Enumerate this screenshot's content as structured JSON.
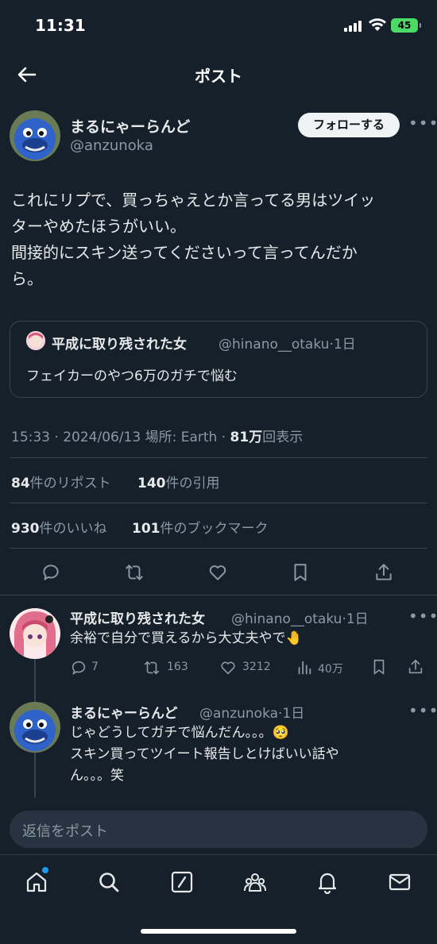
{
  "status_bar": {
    "time": "11:31",
    "battery": "45"
  },
  "header": {
    "title": "ポスト"
  },
  "post": {
    "author_name": "まるにゃーらんど",
    "author_handle": "@anzunoka",
    "follow_label": "フォローする",
    "text": "これにリプで、買っちゃえとか言ってる男はツイッ\nターやめたほうがいい。\n間接的にスキン送ってくださいって言ってんだか\nら。",
    "quote": {
      "name": "平成に取り残された女",
      "handle": "@hinano__otaku·1日",
      "text": "フェイカーのやつ6万のガチで悩む"
    },
    "meta_prefix": "15:33 · 2024/06/13 場所: Earth · ",
    "views_count": "81万",
    "views_label": "回表示",
    "reposts_count": "84",
    "reposts_label": "件のリポスト",
    "quotes_count": "140",
    "quotes_label": "件の引用",
    "likes_count": "930",
    "likes_label": "件のいいね",
    "bookmarks_count": "101",
    "bookmarks_label": "件のブックマーク"
  },
  "replies": [
    {
      "name": "平成に取り残された女",
      "handle": "@hinano__otaku·1日",
      "text": "余裕で自分で買えるから大丈夫やで🤚",
      "replies": "7",
      "reposts": "163",
      "likes": "3212",
      "views": "40万"
    },
    {
      "name": "まるにゃーらんど",
      "handle": "@anzunoka·1日",
      "text": "じゃどうしてガチで悩んだん。。。🥺\nスキン買ってツイート報告しとけばいい話や\nん。。。笑"
    }
  ],
  "reply_bar": {
    "placeholder": "返信をポスト"
  },
  "colors": {
    "background": "#15202b",
    "text": "#e7e9ea",
    "muted": "#8b98a5",
    "divider": "#38444d",
    "accent": "#1d9bf0",
    "battery": "#4cd964"
  }
}
